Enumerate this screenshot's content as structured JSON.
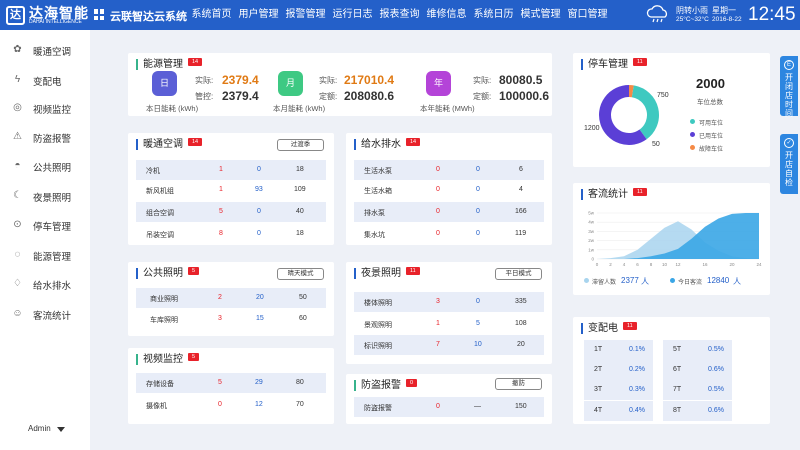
{
  "brand": {
    "logo_mark": "达",
    "name": "达海智能",
    "name_en": "DAHAI INTELLIGENCE",
    "system_title": "云联智达云系统"
  },
  "nav": [
    "系统首页",
    "用户管理",
    "报警管理",
    "运行日志",
    "报表查询",
    "维修信息",
    "系统日历",
    "模式管理",
    "窗口管理"
  ],
  "weather": {
    "text": "阴转小雨",
    "temp": "25°C~32°C",
    "weekday": "星期一",
    "date": "2016-8-22",
    "time": "12:45"
  },
  "sidebar": [
    {
      "label": "暖通空调",
      "icon": "fan-icon"
    },
    {
      "label": "变配电",
      "icon": "lightning-icon"
    },
    {
      "label": "视频监控",
      "icon": "camera-icon"
    },
    {
      "label": "防盗报警",
      "icon": "alarm-icon"
    },
    {
      "label": "公共照明",
      "icon": "lamp-icon"
    },
    {
      "label": "夜景照明",
      "icon": "moon-icon"
    },
    {
      "label": "停车管理",
      "icon": "parking-icon"
    },
    {
      "label": "能源管理",
      "icon": "bulb-icon"
    },
    {
      "label": "给水排水",
      "icon": "drop-icon"
    },
    {
      "label": "客流统计",
      "icon": "user-icon"
    }
  ],
  "admin": "Admin",
  "energy": {
    "title": "能源管理",
    "badge": "14",
    "items": [
      {
        "icon_label": "日",
        "actual_label": "实际:",
        "actual": "2379.4",
        "planned_label": "管控:",
        "planned": "2379.4",
        "caption": "本日能耗 (kWh)",
        "color": "#5b5fd6"
      },
      {
        "icon_label": "月",
        "actual_label": "实际:",
        "actual": "217010.4",
        "planned_label": "定额:",
        "planned": "208080.6",
        "caption": "本月能耗 (kWh)",
        "color": "#3ec983"
      },
      {
        "icon_label": "年",
        "actual_label": "实际:",
        "actual": "80080.5",
        "planned_label": "定额:",
        "planned": "100000.6",
        "caption": "本年能耗 (MWh)",
        "color": "#b444d8"
      }
    ]
  },
  "hvac": {
    "title": "暖通空调",
    "badge": "14",
    "mode": "过渡季",
    "rows": [
      [
        "冷机",
        "1",
        "0",
        "18"
      ],
      [
        "新风机组",
        "1",
        "93",
        "109"
      ],
      [
        "组合空调",
        "5",
        "0",
        "40"
      ],
      [
        "吊装空调",
        "8",
        "0",
        "18"
      ]
    ]
  },
  "water": {
    "title": "给水排水",
    "badge": "14",
    "rows": [
      [
        "生活水泵",
        "0",
        "0",
        "6"
      ],
      [
        "生活水箱",
        "0",
        "0",
        "4"
      ],
      [
        "排水泵",
        "0",
        "0",
        "166"
      ],
      [
        "集水坑",
        "0",
        "0",
        "119"
      ]
    ]
  },
  "public_light": {
    "title": "公共照明",
    "badge": "5",
    "mode": "晴天模式",
    "rows": [
      [
        "商业照明",
        "2",
        "20",
        "50"
      ],
      [
        "车库照明",
        "3",
        "15",
        "60"
      ]
    ]
  },
  "night_light": {
    "title": "夜景照明",
    "badge": "11",
    "mode": "平日模式",
    "rows": [
      [
        "楼体照明",
        "3",
        "0",
        "335"
      ],
      [
        "景观照明",
        "1",
        "5",
        "108"
      ],
      [
        "标识照明",
        "7",
        "10",
        "20"
      ]
    ]
  },
  "video": {
    "title": "视频监控",
    "badge": "5",
    "rows": [
      [
        "存储设备",
        "5",
        "29",
        "80"
      ],
      [
        "摄像机",
        "0",
        "12",
        "70"
      ]
    ]
  },
  "antitheft": {
    "title": "防盗报警",
    "badge": "0",
    "mode": "撤防",
    "rows": [
      [
        "防盗报警",
        "0",
        "—",
        "150"
      ]
    ]
  },
  "parking": {
    "title": "停车管理",
    "badge": "11",
    "total": "2000",
    "total_label": "车位总数",
    "chart_data": {
      "type": "pie",
      "variant": "donut",
      "slices": [
        {
          "name": "可用车位",
          "value": 750,
          "color": "#3ec9c0"
        },
        {
          "name": "已用车位",
          "value": 1200,
          "color": "#5b3fd6"
        },
        {
          "name": "故障车位",
          "value": 50,
          "color": "#f58a46"
        }
      ],
      "labels": [
        "750",
        "1200",
        "50"
      ]
    }
  },
  "traffic": {
    "title": "客流统计",
    "badge": "11",
    "chart_data": {
      "type": "area",
      "x": [
        0,
        2,
        4,
        6,
        8,
        10,
        12,
        14,
        16,
        18,
        20,
        22,
        24
      ],
      "xticks": [
        "0",
        "2",
        "4",
        "6",
        "8",
        "10",
        "12",
        "16",
        "20",
        "24"
      ],
      "yticks": [
        "0",
        "1w",
        "2w",
        "3w",
        "4w",
        "5w"
      ],
      "ylim": [
        0,
        5
      ],
      "series": [
        {
          "name": "滞留人数",
          "values": [
            0,
            0.1,
            0.3,
            1.0,
            2.2,
            3.4,
            4.1,
            3.2,
            1.8,
            0.9,
            0.3,
            0.1,
            0
          ],
          "color": "#a8d4ee"
        },
        {
          "name": "今日客流",
          "values": [
            0,
            0,
            0,
            0.1,
            0.3,
            0.6,
            1.1,
            2.2,
            3.5,
            4.4,
            4.9,
            5.0,
            5.0
          ],
          "color": "#3aa6e6"
        }
      ]
    },
    "stats": [
      {
        "label": "滞留人数",
        "value": "2377",
        "unit": "人"
      },
      {
        "label": "今日客流",
        "value": "12840",
        "unit": "人"
      }
    ]
  },
  "power": {
    "title": "变配电",
    "badge": "11",
    "items": [
      [
        "1T",
        "0.1%"
      ],
      [
        "5T",
        "0.5%"
      ],
      [
        "2T",
        "0.2%"
      ],
      [
        "6T",
        "0.6%"
      ],
      [
        "3T",
        "0.3%"
      ],
      [
        "7T",
        "0.5%"
      ],
      [
        "4T",
        "0.4%"
      ],
      [
        "8T",
        "0.6%"
      ]
    ]
  },
  "right_tabs": [
    {
      "icon": "E",
      "label": "开闭店时间"
    },
    {
      "icon": "✓",
      "label": "开店自检"
    }
  ]
}
